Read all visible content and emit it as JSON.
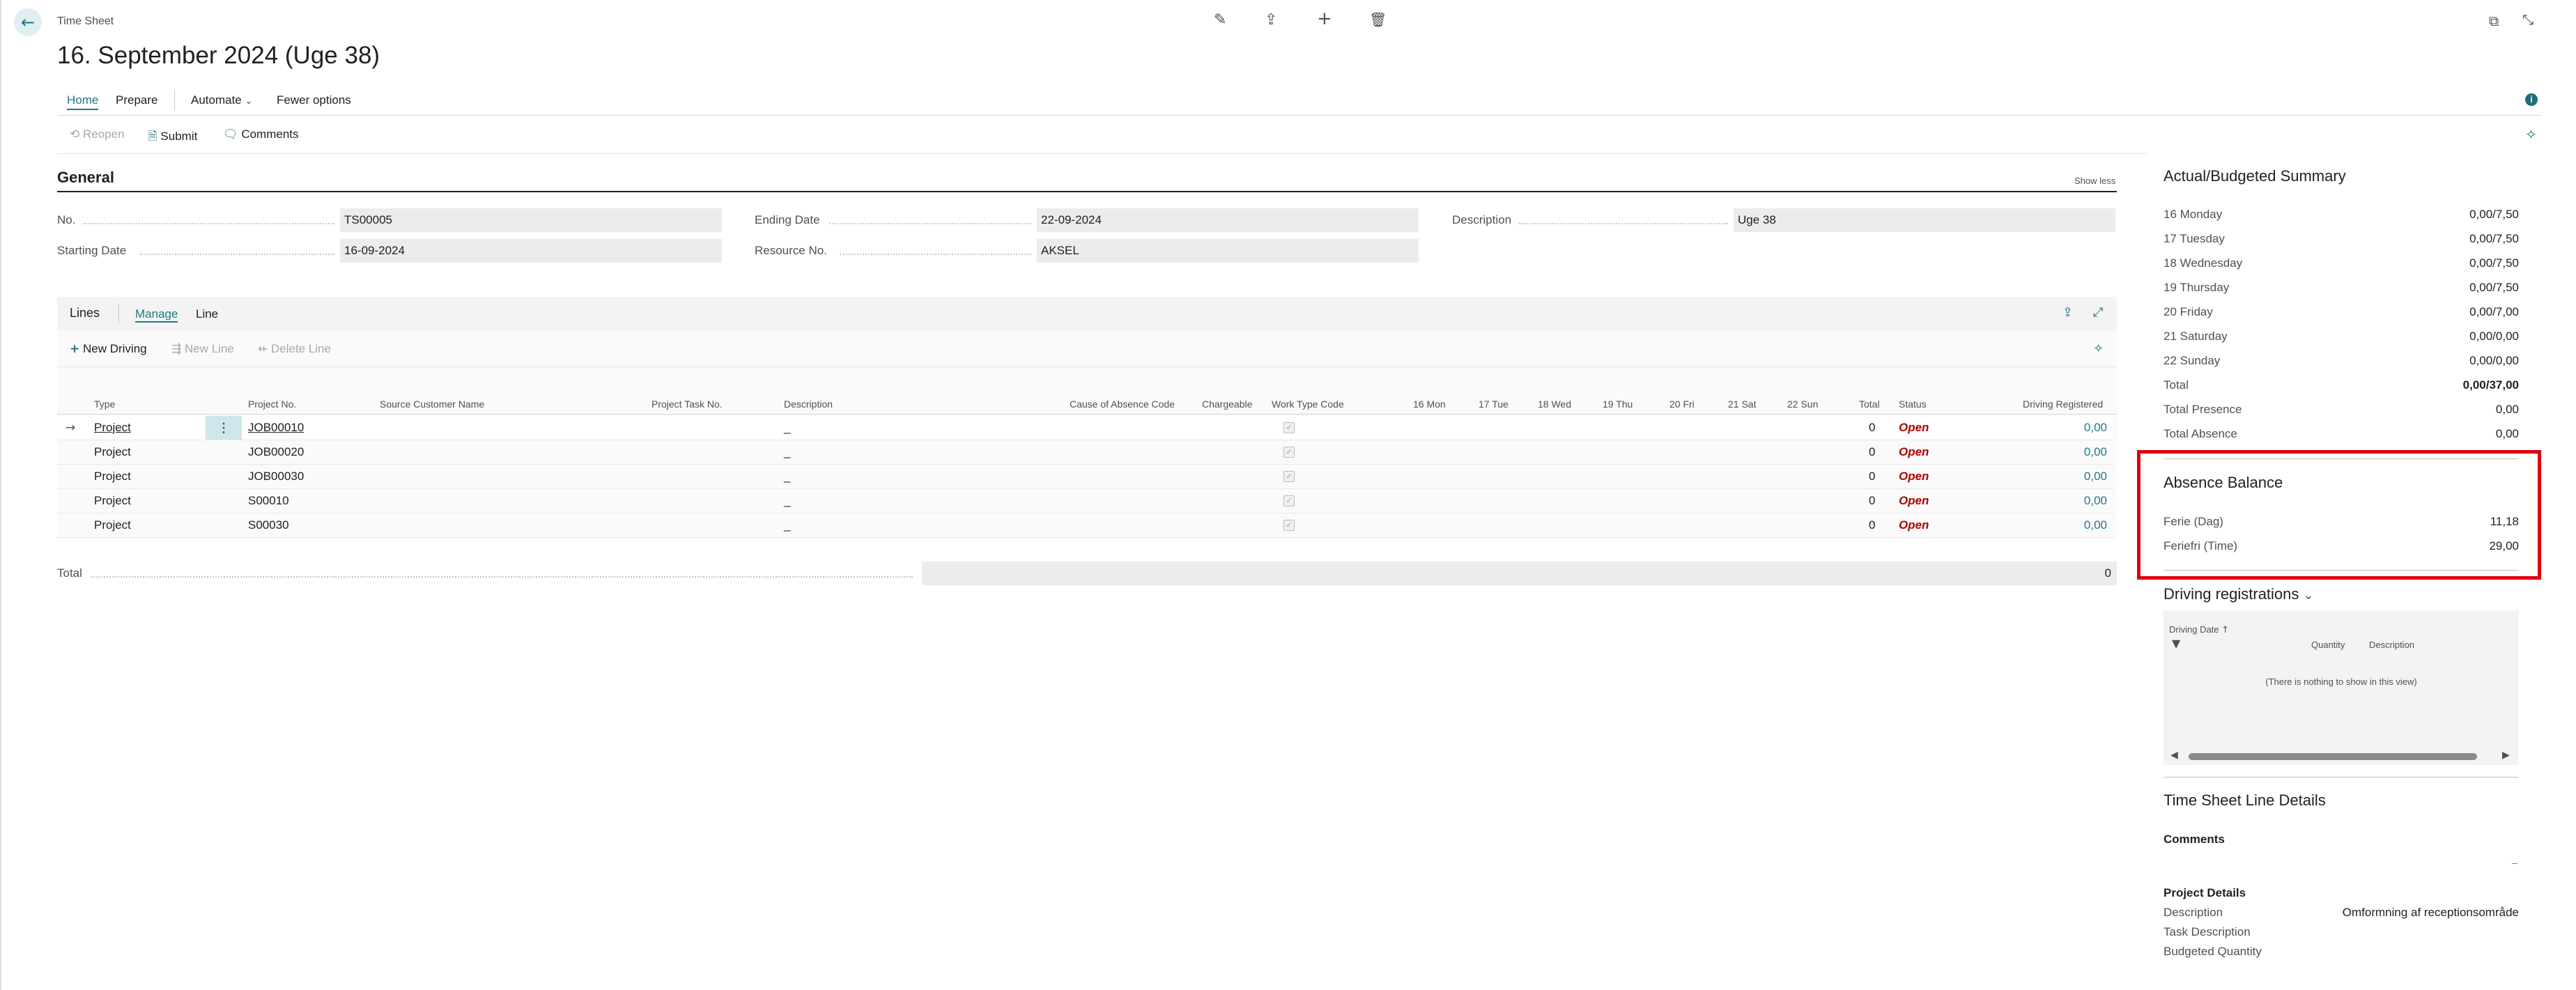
{
  "header": {
    "app_title": "Time Sheet",
    "page_title": "16. September 2024 (Uge 38)"
  },
  "tabs": {
    "home": "Home",
    "prepare": "Prepare",
    "automate": "Automate",
    "fewer_options": "Fewer options"
  },
  "actions": {
    "reopen": "Reopen",
    "submit": "Submit",
    "comments": "Comments"
  },
  "general": {
    "title": "General",
    "show_less": "Show less",
    "no_label": "No.",
    "no_value": "TS00005",
    "starting_date_label": "Starting Date",
    "starting_date_value": "16-09-2024",
    "ending_date_label": "Ending Date",
    "ending_date_value": "22-09-2024",
    "resource_no_label": "Resource No.",
    "resource_no_value": "AKSEL",
    "description_label": "Description",
    "description_value": "Uge 38"
  },
  "lines": {
    "title": "Lines",
    "tab_manage": "Manage",
    "tab_line": "Line",
    "new_driving": "New Driving",
    "new_line": "New Line",
    "delete_line": "Delete Line",
    "columns": [
      "Type",
      "Project No.",
      "Source Customer Name",
      "Project Task No.",
      "Description",
      "Cause of Absence Code",
      "Chargeable",
      "Work Type Code",
      "16 Mon",
      "17 Tue",
      "18 Wed",
      "19 Thu",
      "20 Fri",
      "21 Sat",
      "22 Sun",
      "Total",
      "Status",
      "Driving Registered"
    ],
    "rows": [
      {
        "type": "Project",
        "project_no": "JOB00010",
        "description": "_",
        "total": "0",
        "status": "Open",
        "driving": "0,00"
      },
      {
        "type": "Project",
        "project_no": "JOB00020",
        "description": "_",
        "total": "0",
        "status": "Open",
        "driving": "0,00"
      },
      {
        "type": "Project",
        "project_no": "JOB00030",
        "description": "_",
        "total": "0",
        "status": "Open",
        "driving": "0,00"
      },
      {
        "type": "Project",
        "project_no": "S00010",
        "description": "_",
        "total": "0",
        "status": "Open",
        "driving": "0,00"
      },
      {
        "type": "Project",
        "project_no": "S00030",
        "description": "_",
        "total": "0",
        "status": "Open",
        "driving": "0,00"
      }
    ],
    "total_label": "Total",
    "total_value": "0"
  },
  "summary": {
    "title": "Actual/Budgeted Summary",
    "rows": [
      {
        "label": "16 Monday",
        "value": "0,00/7,50"
      },
      {
        "label": "17 Tuesday",
        "value": "0,00/7,50"
      },
      {
        "label": "18 Wednesday",
        "value": "0,00/7,50"
      },
      {
        "label": "19 Thursday",
        "value": "0,00/7,50"
      },
      {
        "label": "20 Friday",
        "value": "0,00/7,00"
      },
      {
        "label": "21 Saturday",
        "value": "0,00/0,00"
      },
      {
        "label": "22 Sunday",
        "value": "0,00/0,00"
      },
      {
        "label": "Total",
        "value": "0,00/37,00"
      },
      {
        "label": "Total Presence",
        "value": "0,00"
      },
      {
        "label": "Total Absence",
        "value": "0,00"
      }
    ]
  },
  "absence": {
    "title": "Absence Balance",
    "rows": [
      {
        "label": "Ferie (Dag)",
        "value": "11,18"
      },
      {
        "label": "Feriefri (Time)",
        "value": "29,00"
      }
    ],
    "highlight_color": "#e0000f"
  },
  "driving": {
    "title": "Driving registrations",
    "col_date": "Driving Date",
    "col_quantity": "Quantity",
    "col_description": "Description",
    "empty": "(There is nothing to show in this view)"
  },
  "details": {
    "title": "Time Sheet Line Details",
    "comments_label": "Comments",
    "comments_value": "_",
    "project_details": "Project Details",
    "description_label": "Description",
    "description_value": "Omformning af receptionsområde",
    "task_description_label": "Task Description",
    "budgeted_quantity_label": "Budgeted Quantity"
  }
}
